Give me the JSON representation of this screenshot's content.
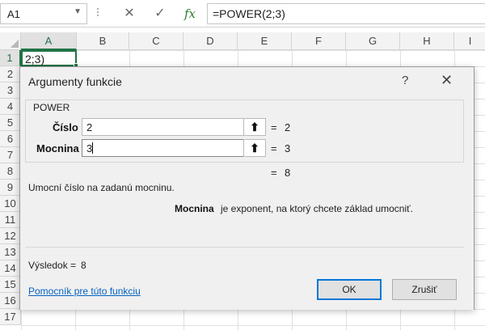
{
  "formula_bar": {
    "name_box": "A1",
    "cancel_icon": "✕",
    "enter_icon": "✓",
    "fx_label": "fx",
    "formula": "=POWER(2;3)"
  },
  "columns": [
    "A",
    "B",
    "C",
    "D",
    "E",
    "F",
    "G",
    "H",
    "I"
  ],
  "rows": [
    "1",
    "2",
    "3",
    "4",
    "5",
    "6",
    "7",
    "8",
    "9",
    "10",
    "11",
    "12",
    "13",
    "14",
    "15",
    "16",
    "17"
  ],
  "active_cell_value": "2;3)",
  "dialog": {
    "title": "Argumenty funkcie",
    "help_icon": "?",
    "close_icon": "✕",
    "function_name": "POWER",
    "args": [
      {
        "label": "Číslo",
        "value": "2",
        "result": "2"
      },
      {
        "label": "Mocnina",
        "value": "3",
        "result": "3"
      }
    ],
    "eq_sign": "=",
    "collapse_icon": "⬆",
    "overall_result": "8",
    "description": "Umocní číslo na zadanú mocninu.",
    "arg_desc_name": "Mocnina",
    "arg_desc_text": "je exponent, na ktorý chcete základ umocniť.",
    "result_label": "Výsledok =",
    "result_value": "8",
    "help_link": "Pomocník pre túto funkciu",
    "ok_label": "OK",
    "cancel_label": "Zrušiť"
  }
}
